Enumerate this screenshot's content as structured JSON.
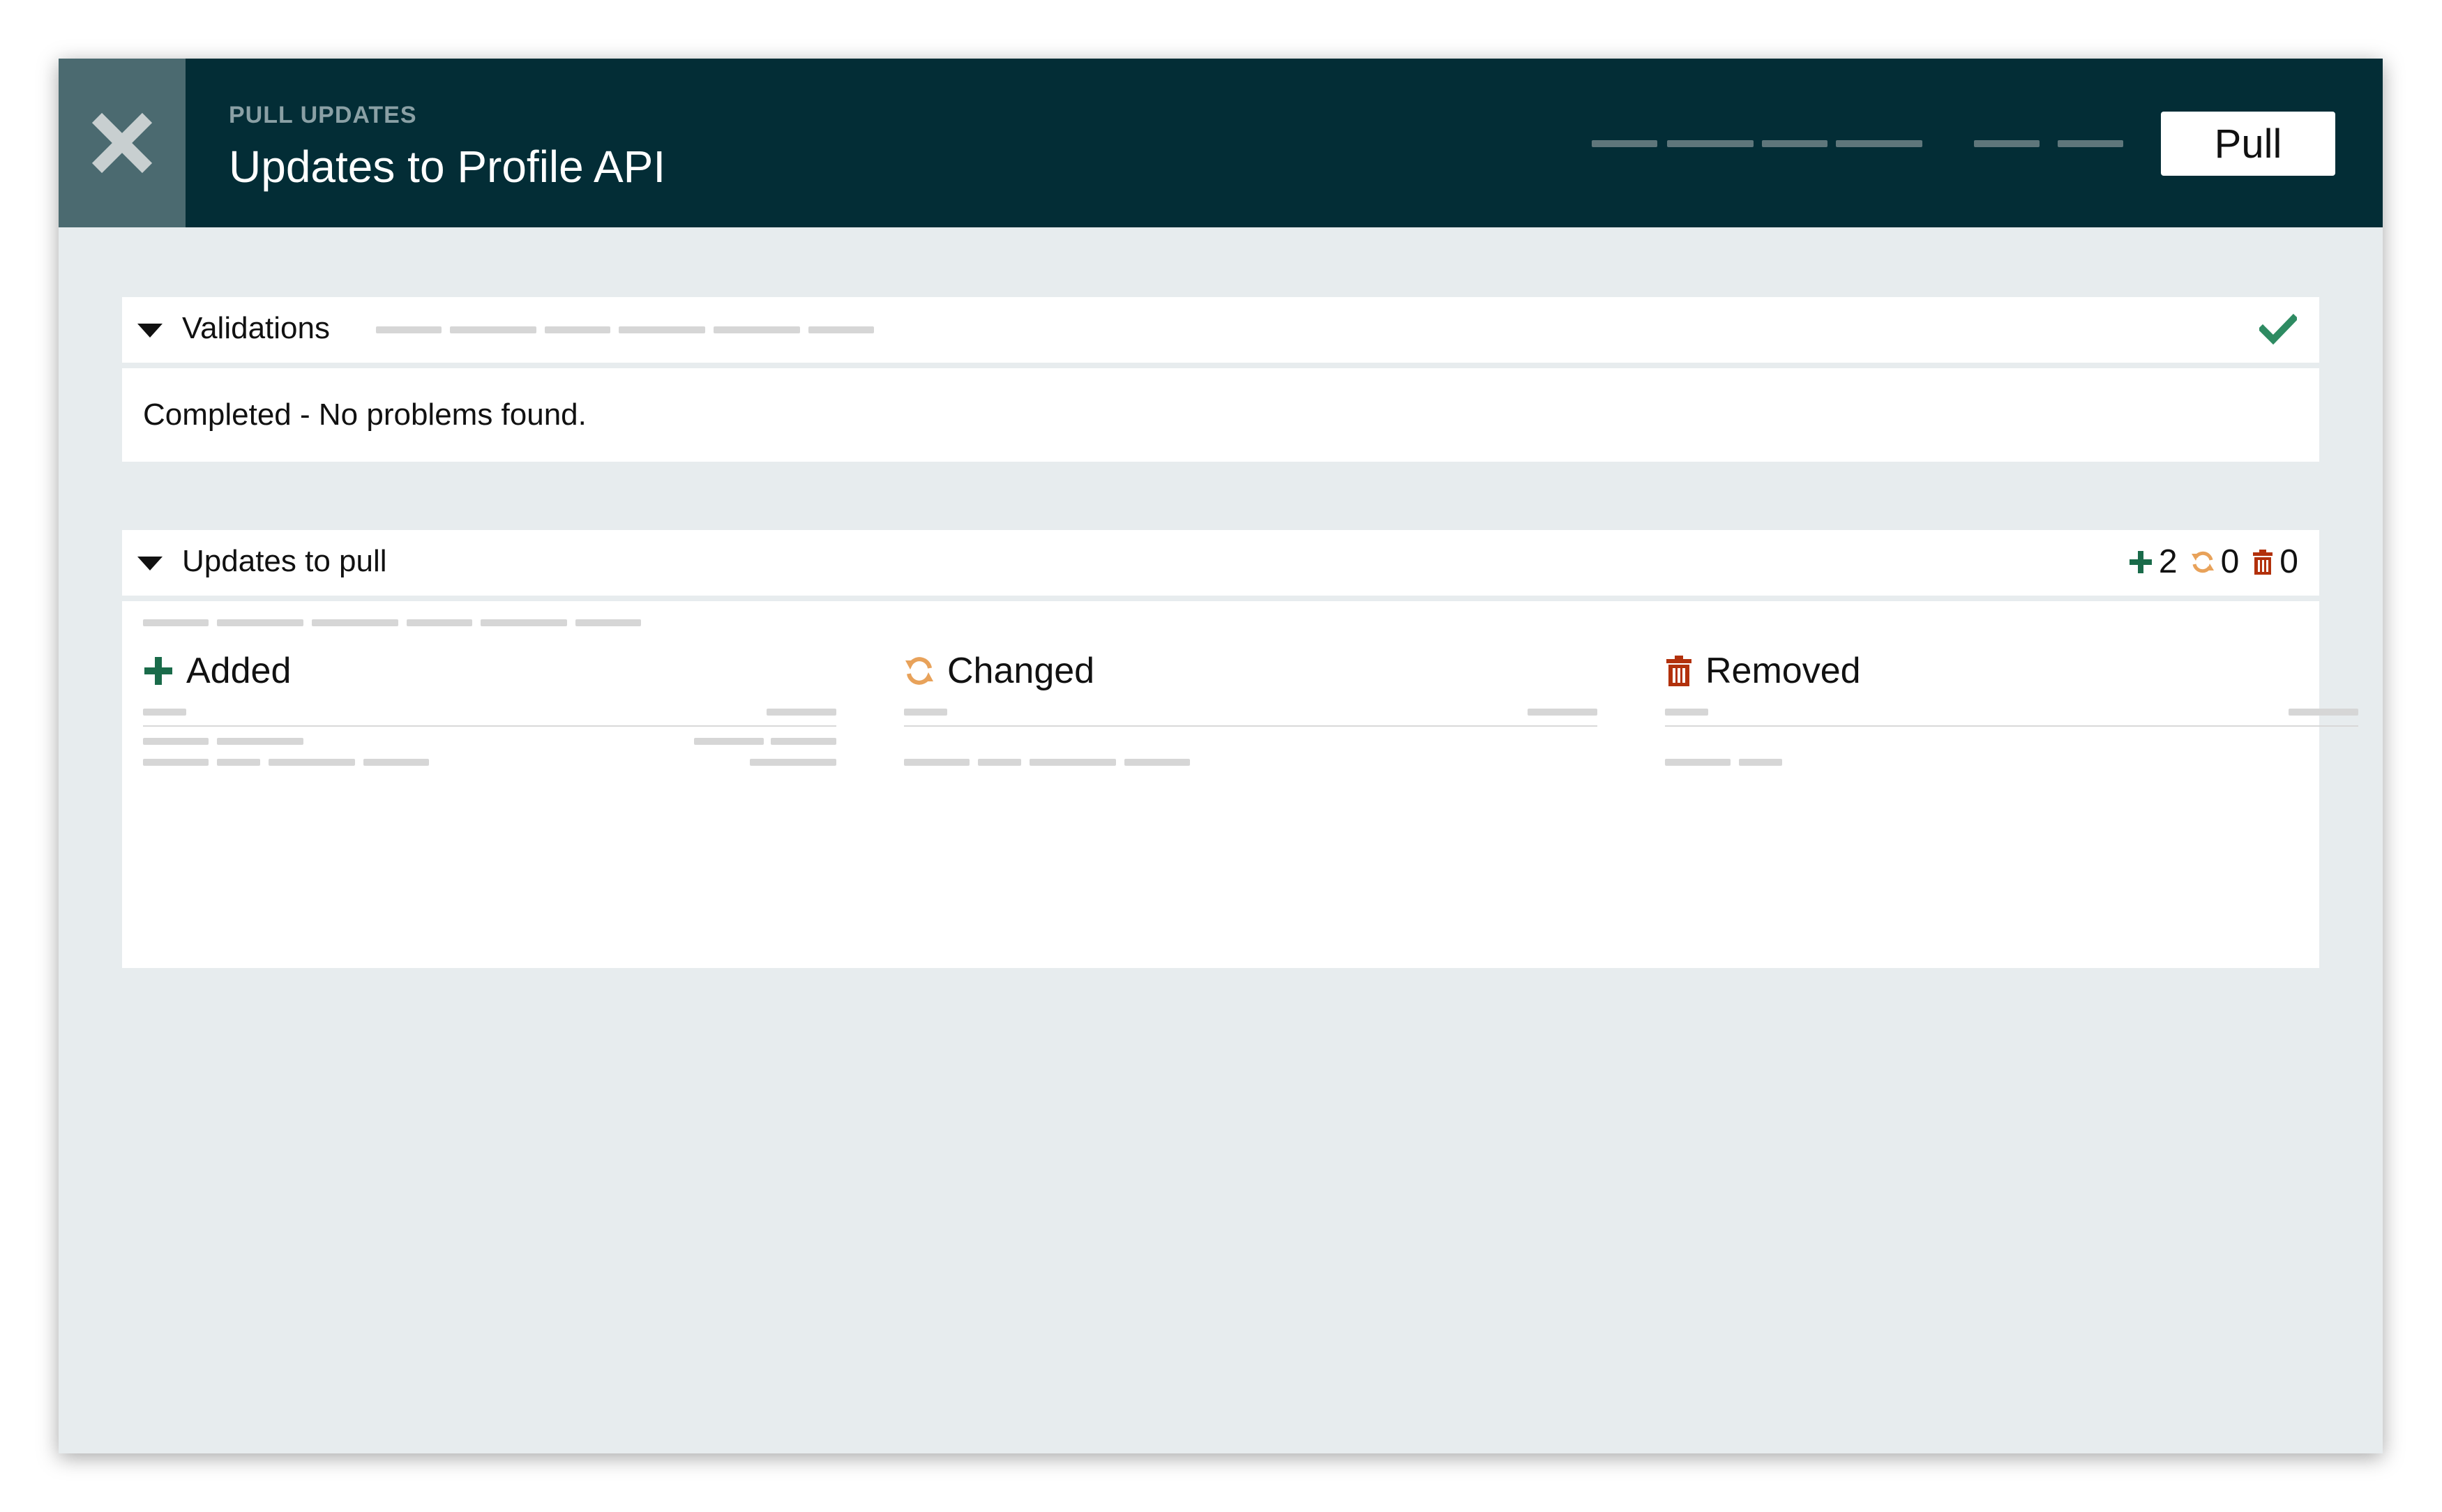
{
  "header": {
    "subtitle": "PULL UPDATES",
    "title": "Updates to Profile API",
    "pull_label": "Pull",
    "close_icon": "close-icon"
  },
  "validations": {
    "title": "Validations",
    "status_icon": "check-icon",
    "status_color": "#2e8b62",
    "message": "Completed - No problems found."
  },
  "updates": {
    "title": "Updates to pull",
    "counts": {
      "added": "2",
      "changed": "0",
      "removed": "0"
    },
    "columns": {
      "added": {
        "label": "Added",
        "icon": "plus-icon",
        "color": "#1a6b4a"
      },
      "changed": {
        "label": "Changed",
        "icon": "refresh-icon",
        "color": "#e8a25a"
      },
      "removed": {
        "label": "Removed",
        "icon": "trash-icon",
        "color": "#b2310c"
      }
    }
  },
  "colors": {
    "header_bg": "#032d36",
    "close_bg": "#4b6a70",
    "page_bg": "#e7ecee"
  }
}
